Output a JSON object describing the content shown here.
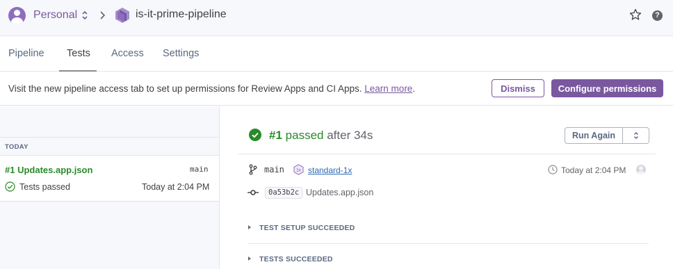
{
  "header": {
    "account": "Personal",
    "pipeline_name": "is-it-prime-pipeline",
    "help_glyph": "?",
    "icons": [
      "user-avatar-icon",
      "chevron-up-down-icon",
      "chevron-right-icon",
      "pipeline-hex-icon",
      "star-icon",
      "help-icon"
    ],
    "accent_color": "#79589f"
  },
  "tabs": [
    {
      "label": "Pipeline"
    },
    {
      "label": "Tests",
      "active": true
    },
    {
      "label": "Access"
    },
    {
      "label": "Settings"
    }
  ],
  "banner": {
    "text": "Visit the new pipeline access tab to set up permissions for Review Apps and CI Apps. ",
    "link": "Learn more",
    "suffix": ".",
    "dismiss_label": "Dismiss",
    "configure_label": "Configure permissions"
  },
  "sidebar": {
    "group_label": "TODAY",
    "runs": [
      {
        "title": "#1 Updates.app.json",
        "branch": "main",
        "status": "Tests passed",
        "time": "Today at 2:04 PM"
      }
    ]
  },
  "run": {
    "number": "#1",
    "status": "passed",
    "duration": "after 34s",
    "run_again_label": "Run Again",
    "branch": "main",
    "dyno_badge": "1x",
    "dyno_size": "standard-1x",
    "time": "Today at 2:04 PM",
    "commit_sha": "0a53b2c",
    "commit_message": "Updates.app.json",
    "sections": [
      {
        "label": "TEST SETUP SUCCEEDED"
      },
      {
        "label": "TESTS SUCCEEDED"
      }
    ],
    "success_color": "#2a8a2a"
  }
}
